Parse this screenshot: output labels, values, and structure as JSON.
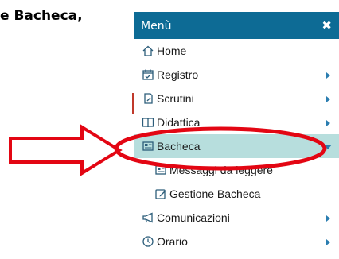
{
  "doc_text": "e Bacheca,",
  "menu": {
    "title": "Menù",
    "close_symbol": "✖",
    "items": [
      {
        "label": "Home",
        "icon": "home-icon"
      },
      {
        "label": "Registro",
        "icon": "calendar-icon"
      },
      {
        "label": "Scrutini",
        "icon": "document-edit-icon"
      },
      {
        "label": "Didattica",
        "icon": "book-icon"
      },
      {
        "label": "Bacheca",
        "icon": "newspaper-icon"
      },
      {
        "label": "Messaggi da leggere",
        "icon": "newspaper-icon"
      },
      {
        "label": "Gestione Bacheca",
        "icon": "edit-icon"
      },
      {
        "label": "Comunicazioni",
        "icon": "megaphone-icon"
      },
      {
        "label": "Orario",
        "icon": "clock-icon"
      }
    ]
  },
  "colors": {
    "header": "#0d6b95",
    "active": "#b7dedd",
    "highlight_red": "#e30613"
  }
}
